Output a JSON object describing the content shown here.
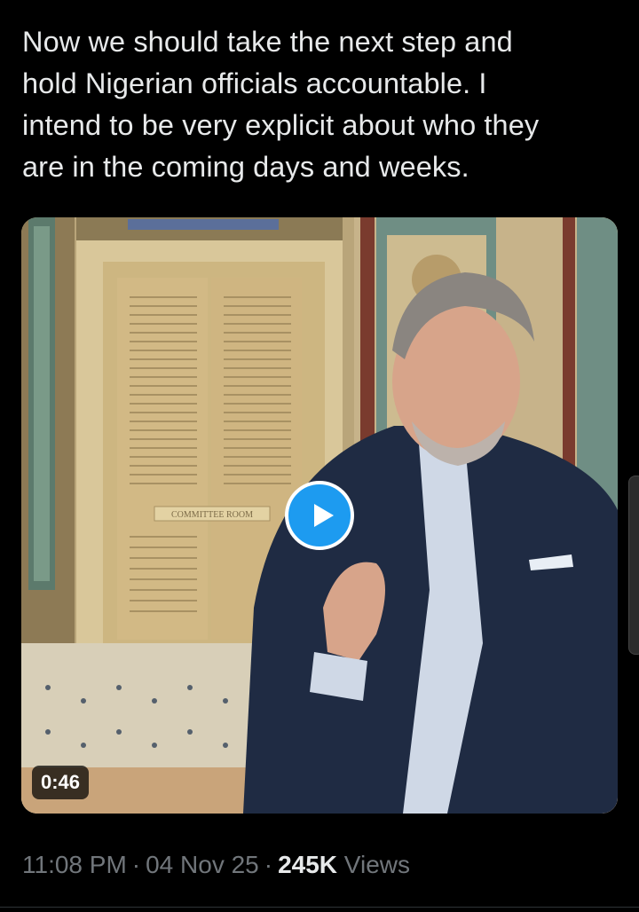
{
  "tweet": {
    "text_lines": [
      "Now we should take the next step and",
      "hold Nigerian officials accountable. I",
      "intend to be very explicit about who they",
      "are in the coming days and weeks."
    ]
  },
  "video": {
    "door_sign": "COMMITTEE ROOM",
    "duration": "0:46",
    "play_icon": "play-icon"
  },
  "meta": {
    "time": "11:08 PM",
    "separator": "·",
    "date": "04 Nov 25",
    "views_count": "245K",
    "views_label": "Views"
  },
  "colors": {
    "background": "#000000",
    "text": "#e7e9ea",
    "secondary_text": "#71767b",
    "accent": "#1d9bf0"
  }
}
